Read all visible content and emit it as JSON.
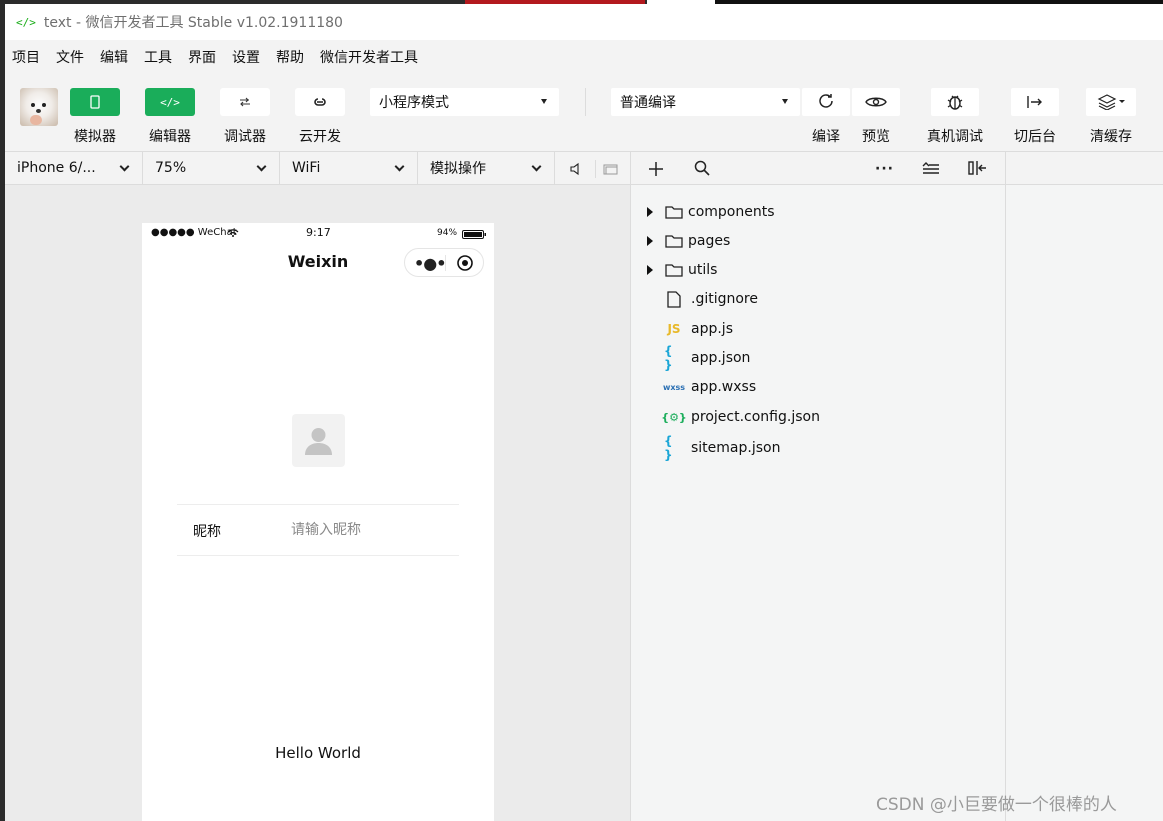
{
  "window": {
    "title": "text - 微信开发者工具 Stable v1.02.1911180"
  },
  "menu": [
    "项目",
    "文件",
    "编辑",
    "工具",
    "界面",
    "设置",
    "帮助",
    "微信开发者工具"
  ],
  "toolbar": {
    "simulator_label": "模拟器",
    "editor_label": "编辑器",
    "debugger_label": "调试器",
    "cloud_label": "云开发",
    "mode_select": "小程序模式",
    "compile_select": "普通编译",
    "compile_label": "编译",
    "preview_label": "预览",
    "realdebug_label": "真机调试",
    "background_label": "切后台",
    "cache_label": "清缓存"
  },
  "subbar": {
    "device": "iPhone 6/...",
    "zoom": "75%",
    "network": "WiFi",
    "operation": "模拟操作"
  },
  "phone": {
    "status_left": "●●●●● WeChat",
    "status_time": "9:17",
    "status_battery": "94%",
    "nav_title": "Weixin",
    "nickname_label": "昵称",
    "nickname_placeholder": "请输入昵称",
    "hello_text": "Hello World"
  },
  "explorer": {
    "items": [
      {
        "name": "components",
        "type": "folder"
      },
      {
        "name": "pages",
        "type": "folder"
      },
      {
        "name": "utils",
        "type": "folder"
      },
      {
        "name": ".gitignore",
        "type": "file"
      },
      {
        "name": "app.js",
        "type": "js",
        "badge": "JS"
      },
      {
        "name": "app.json",
        "type": "json",
        "badge": "{ }"
      },
      {
        "name": "app.wxss",
        "type": "wxss",
        "badge": "wxss"
      },
      {
        "name": "project.config.json",
        "type": "config",
        "badge": "{⚙}"
      },
      {
        "name": "sitemap.json",
        "type": "json",
        "badge": "{ }"
      }
    ]
  },
  "watermark": "CSDN @小巨要做一个很棒的人",
  "colors": {
    "accent_green": "#1aad5a",
    "js_yellow": "#e8b92a",
    "json_cyan": "#1ba6d6",
    "wxss_blue": "#2a6fb3",
    "config_green": "#1aad5a"
  }
}
